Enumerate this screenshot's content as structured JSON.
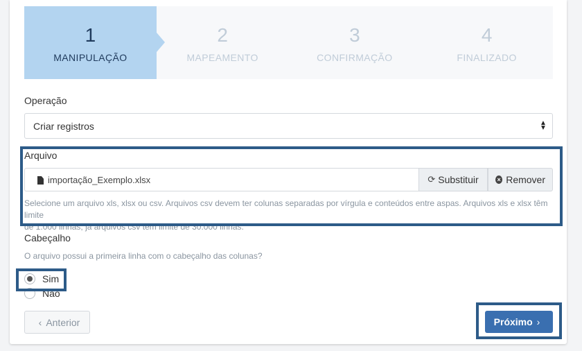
{
  "steps": [
    {
      "num": "1",
      "label": "MANIPULAÇÃO",
      "active": true
    },
    {
      "num": "2",
      "label": "MAPEAMENTO",
      "active": false
    },
    {
      "num": "3",
      "label": "CONFIRMAÇÃO",
      "active": false
    },
    {
      "num": "4",
      "label": "FINALIZADO",
      "active": false
    }
  ],
  "operation": {
    "label": "Operação",
    "value": "Criar registros"
  },
  "file": {
    "label": "Arquivo",
    "filename": "importação_Exemplo.xlsx",
    "replace_label": "Substituir",
    "remove_label": "Remover",
    "help_line1": "Selecione um arquivo xls, xlsx ou csv. Arquivos csv devem ter colunas separadas por vírgula e conteúdos entre aspas. Arquivos xls e xlsx têm limite",
    "help_line2": "de 1.000 linhas, já arquivos csv têm limite de 30.000 linhas."
  },
  "header": {
    "label": "Cabeçalho",
    "question": "O arquivo possui a primeira linha com o cabeçalho das colunas?",
    "options": [
      {
        "label": "Sim",
        "selected": true
      },
      {
        "label": "Não",
        "selected": false
      }
    ]
  },
  "nav": {
    "prev_label": "Anterior",
    "next_label": "Próximo"
  },
  "colors": {
    "active_step": "#b3d4f0",
    "primary": "#3a6fb0",
    "highlight_border": "#2d5b88"
  }
}
